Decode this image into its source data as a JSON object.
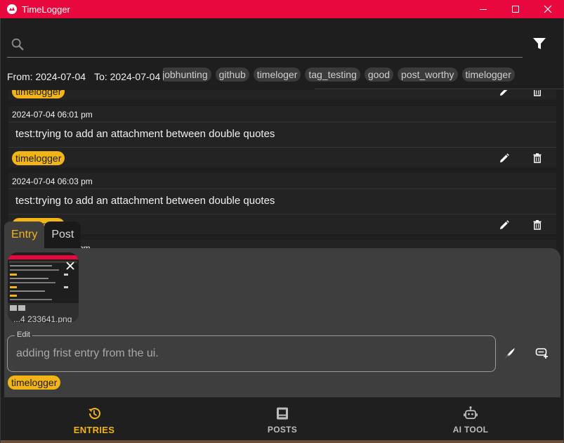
{
  "window": {
    "title": "TimeLogger",
    "controls": {
      "minimize_icon": "minimize-icon",
      "maximize_icon": "maximize-icon",
      "close_icon": "close-icon"
    }
  },
  "search": {
    "placeholder": "",
    "value": ""
  },
  "filter": {
    "icon": "filter-icon"
  },
  "date_range": {
    "from": "From: 2024-07-04",
    "to": "To: 2024-07-04"
  },
  "tag_chips": [
    "jobhunting",
    "github",
    "timeloger",
    "tag_testing",
    "good",
    "post_worthy",
    "timelogger"
  ],
  "entries": [
    {
      "date": "",
      "text": "",
      "tag": "timelogger"
    },
    {
      "date": "2024-07-04 06:01 pm",
      "text": "test:trying to add an attachment between double quotes",
      "tag": "timelogger"
    },
    {
      "date": "2024-07-04 06:03 pm",
      "text": "test:trying to add an attachment between double quotes",
      "tag": "timelogger"
    },
    {
      "date": "pm",
      "text": "",
      "tag": ""
    }
  ],
  "compose": {
    "tabs": [
      {
        "label": "Entry",
        "active": true
      },
      {
        "label": "Post",
        "active": false
      }
    ],
    "attachment": {
      "filename": "...4 233641.png"
    },
    "edit_field": {
      "label": "Edit",
      "value": "adding frist entry from the ui."
    },
    "tag": "timelogger"
  },
  "bottom_nav": [
    {
      "label": "ENTRIES",
      "icon": "history-icon",
      "active": true
    },
    {
      "label": "POSTS",
      "icon": "posts-icon",
      "active": false
    },
    {
      "label": "AI TOOL",
      "icon": "robot-icon",
      "active": false
    }
  ],
  "colors": {
    "titlebar": "#e8083e",
    "accent": "#f3b416",
    "background": "#1e1e1e",
    "panel": "#3e3e3e"
  }
}
